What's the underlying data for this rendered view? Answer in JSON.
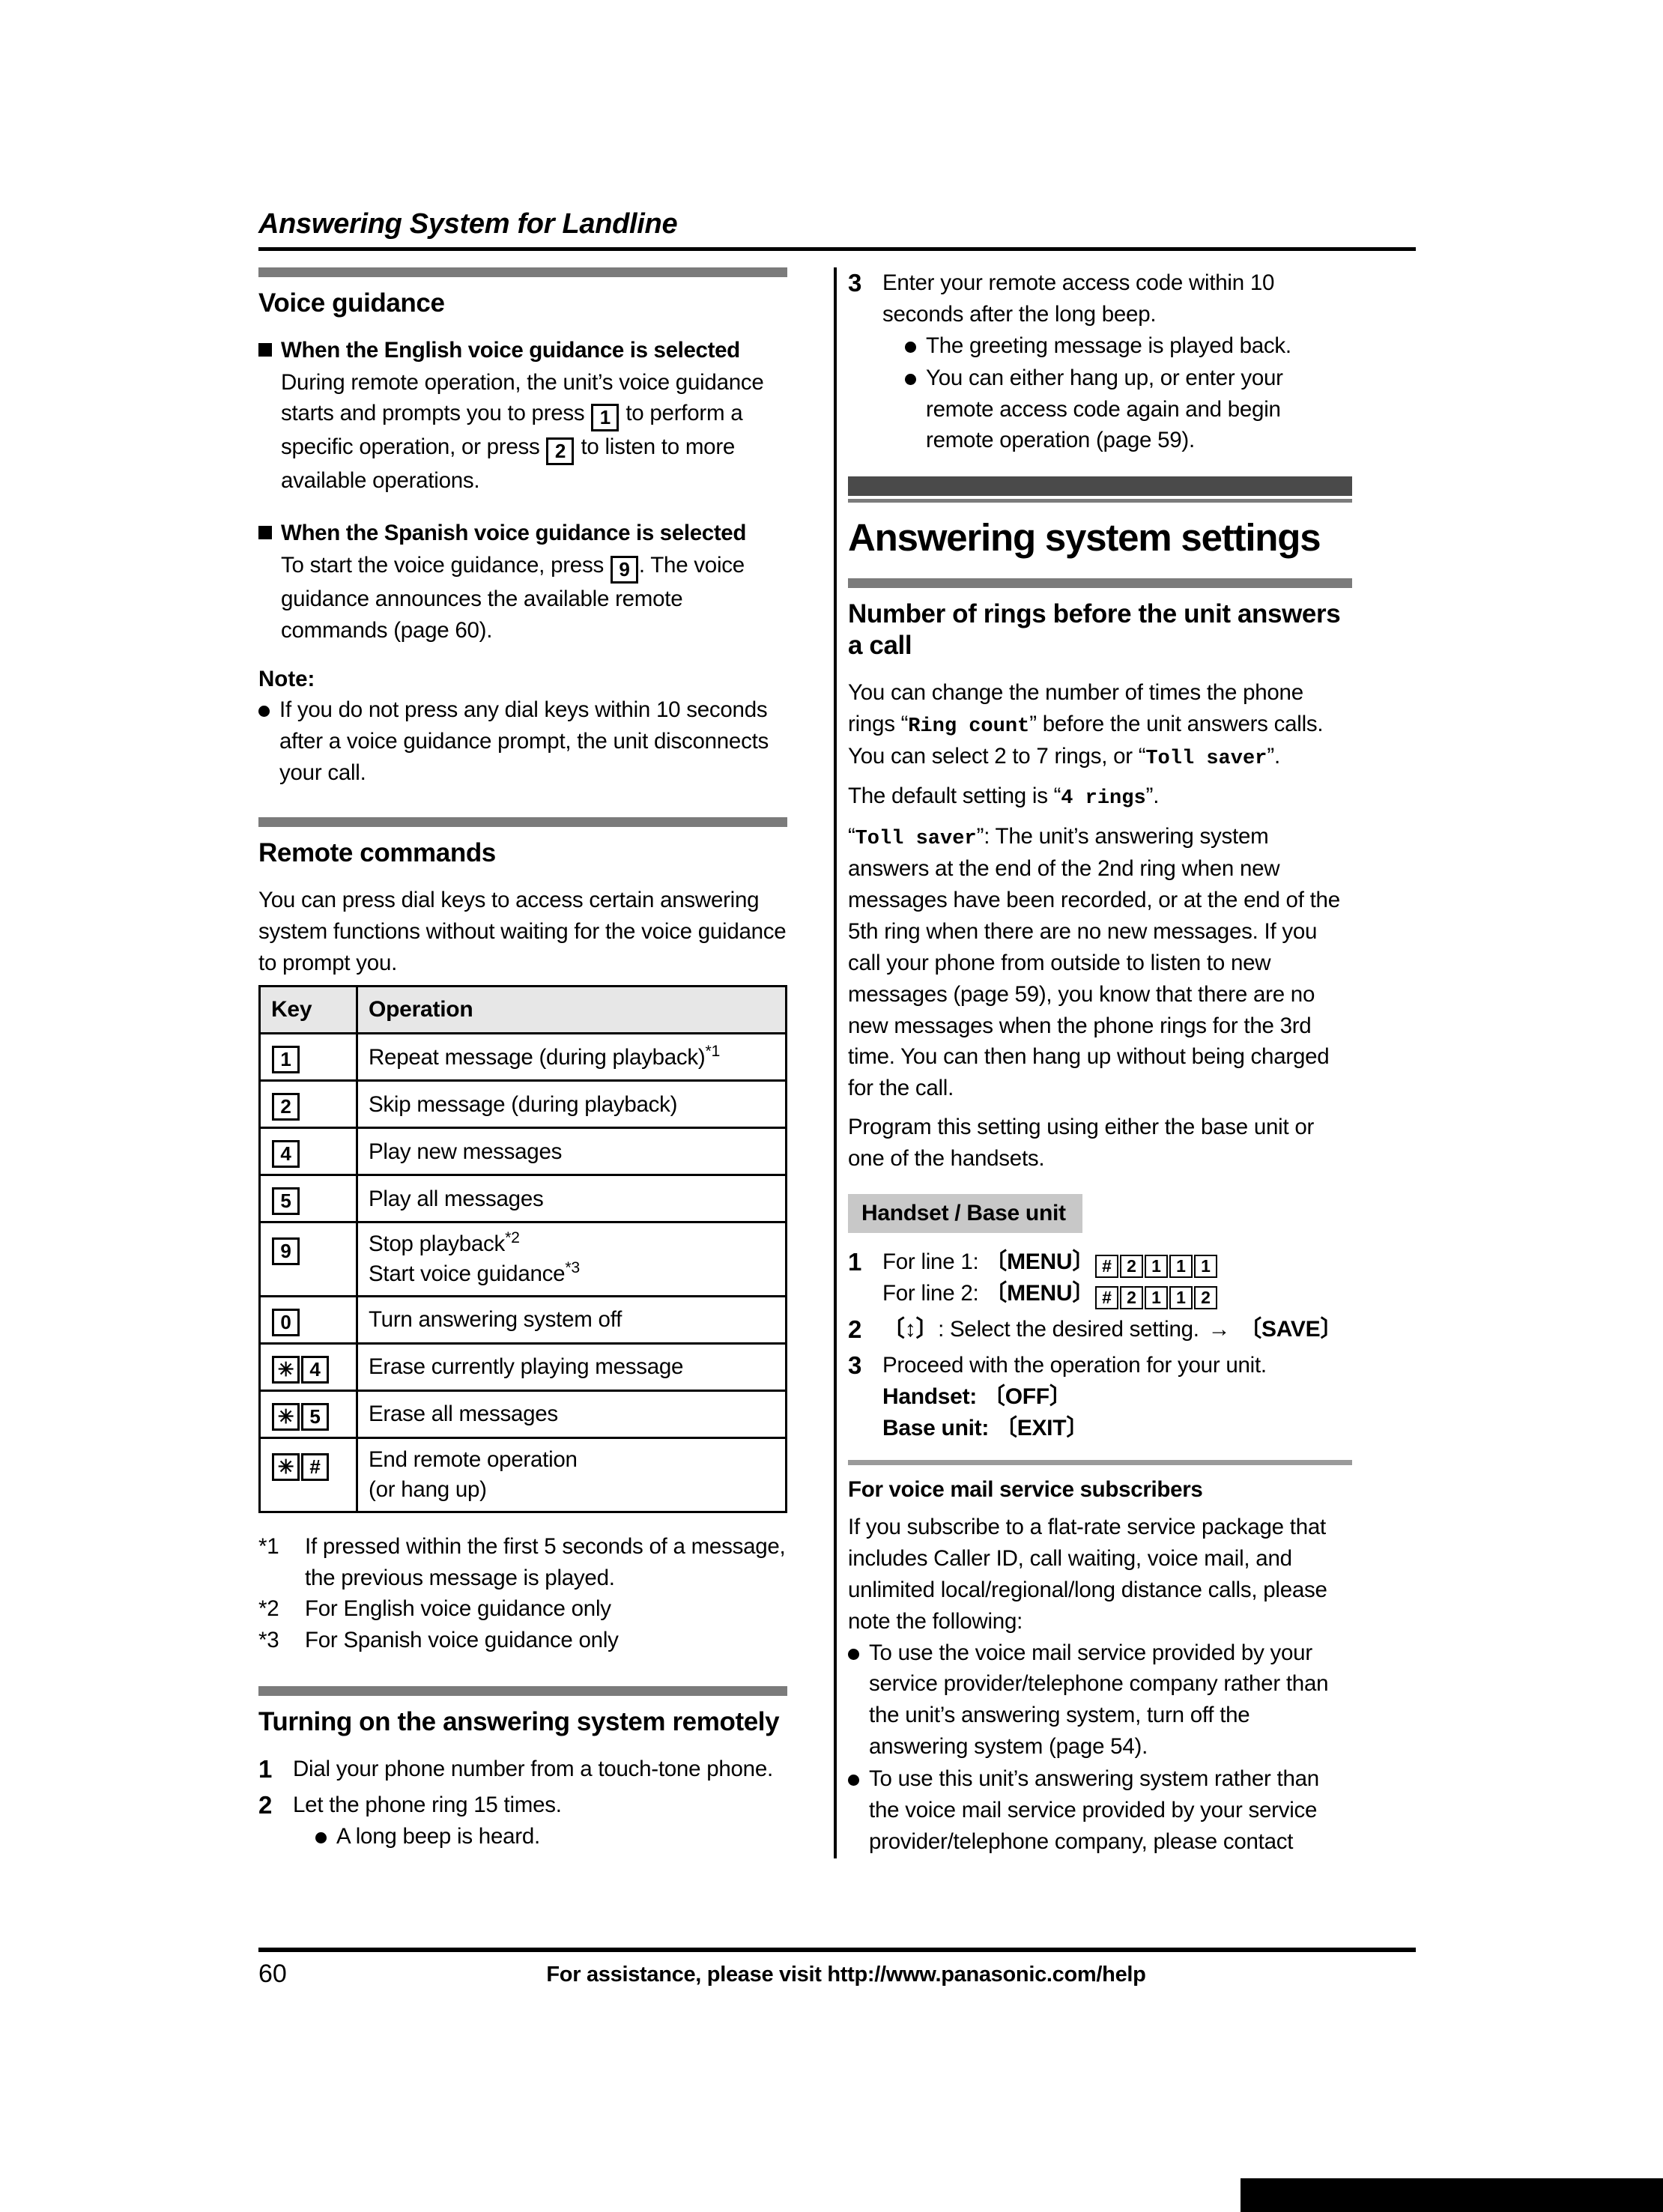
{
  "running_head": "Answering System for Landline",
  "left_column": {
    "voice_guidance": {
      "title": "Voice guidance",
      "blocks": [
        {
          "heading": "When the English voice guidance is selected",
          "body_1": "During remote operation, the unit’s voice guidance starts and prompts you to press",
          "key_1": "1",
          "body_2": "to perform a specific operation, or press",
          "key_2": "2",
          "body_3": "to listen to more available operations."
        },
        {
          "heading": "When the Spanish voice guidance is selected",
          "body_1": "To start the voice guidance, press",
          "key_1": "9",
          "body_2": ". The voice guidance announces the available remote commands (page 60)."
        }
      ],
      "note_label": "Note:",
      "note_bullet": "If you do not press any dial keys within 10 seconds after a voice guidance prompt, the unit disconnects your call."
    },
    "remote_commands": {
      "title": "Remote commands",
      "intro": "You can press dial keys to access certain answering system functions without waiting for the voice guidance to prompt you.",
      "table": {
        "headers": [
          "Key",
          "Operation"
        ],
        "rows": [
          {
            "keys": [
              "1"
            ],
            "operation": "Repeat message (during playback)",
            "footnote": "*1"
          },
          {
            "keys": [
              "2"
            ],
            "operation": "Skip message (during playback)",
            "footnote": ""
          },
          {
            "keys": [
              "4"
            ],
            "operation": "Play new messages",
            "footnote": ""
          },
          {
            "keys": [
              "5"
            ],
            "operation": "Play all messages",
            "footnote": ""
          },
          {
            "keys": [
              "9"
            ],
            "operation": "Stop playback",
            "footnote": "*2",
            "operation_line2": "Start voice guidance",
            "footnote2": "*3"
          },
          {
            "keys": [
              "0"
            ],
            "operation": "Turn answering system off",
            "footnote": ""
          },
          {
            "keys": [
              "✳",
              "4"
            ],
            "operation": "Erase currently playing message",
            "footnote": ""
          },
          {
            "keys": [
              "✳",
              "5"
            ],
            "operation": "Erase all messages",
            "footnote": ""
          },
          {
            "keys": [
              "✳",
              "#"
            ],
            "operation": "End remote operation",
            "footnote": "",
            "operation_line2": "(or hang up)"
          }
        ]
      },
      "footnotes": [
        {
          "mark": "*1",
          "text": "If pressed within the first 5 seconds of a message, the previous message is played."
        },
        {
          "mark": "*2",
          "text": "For English voice guidance only"
        },
        {
          "mark": "*3",
          "text": "For Spanish voice guidance only"
        }
      ]
    },
    "turning_on": {
      "title": "Turning on the answering system remotely",
      "steps": [
        {
          "num": "1",
          "text": "Dial your phone number from a touch-tone phone."
        },
        {
          "num": "2",
          "text": "Let the phone ring 15 times.",
          "bullets": [
            "A long beep is heard."
          ]
        }
      ]
    }
  },
  "right_column": {
    "continued_step": {
      "num": "3",
      "text": "Enter your remote access code within 10 seconds after the long beep.",
      "bullets": [
        "The greeting message is played back.",
        "You can either hang up, or enter your remote access code again and begin remote operation (page 59)."
      ]
    },
    "chapter_title": "Answering system settings",
    "number_of_rings": {
      "title": "Number of rings before the unit answers a call",
      "p1_a": "You can change the number of times the phone rings ",
      "p1_setting": "Ring count",
      "p1_b": " before the unit answers calls. You can select 2 to 7 rings, or ",
      "p1_setting2": "Toll saver",
      "p1_c": ".",
      "p2_a": "The default setting is ",
      "p2_setting": "4 rings",
      "p2_b": ".",
      "p3_setting": "Toll saver",
      "p3_text": ": The unit’s answering system answers at the end of the 2nd ring when new messages have been recorded, or at the end of the 5th ring when there are no new messages. If you call your phone from outside to listen to new messages (page 59), you know that there are no new messages when the phone rings for the 3rd time. You can then hang up without being charged for the call.",
      "p4": "Program this setting using either the base unit or one of the handsets.",
      "device_label": "Handset / Base unit",
      "steps": [
        {
          "num": "1",
          "line1_prefix": "For line 1: ",
          "line1_menu": "〔MENU〕",
          "line1_keys": [
            "#",
            "2",
            "1",
            "1",
            "1"
          ],
          "line2_prefix": "For line 2: ",
          "line2_menu": "〔MENU〕",
          "line2_keys": [
            "#",
            "2",
            "1",
            "1",
            "2"
          ]
        },
        {
          "num": "2",
          "updown": "〔↕〕",
          "text": ": Select the desired setting.",
          "arrow": "→",
          "save": "〔SAVE〕"
        },
        {
          "num": "3",
          "text": "Proceed with the operation for your unit.",
          "handset_label": "Handset: ",
          "handset_key": "〔OFF〕",
          "base_label": "Base unit: ",
          "base_key": "〔EXIT〕"
        }
      ]
    },
    "voice_mail": {
      "title": "For voice mail service subscribers",
      "intro": "If you subscribe to a flat-rate service package that includes Caller ID, call waiting, voice mail, and unlimited local/regional/long distance calls, please note the following:",
      "bullets": [
        "To use the voice mail service provided by your service provider/telephone company rather than the unit’s answering system, turn off the answering system (page 54).",
        "To use this unit’s answering system rather than the voice mail service provided by your service provider/telephone company, please contact"
      ]
    }
  },
  "footer": {
    "page_number": "60",
    "assistance_text": "For assistance, please visit http://www.panasonic.com/help"
  }
}
